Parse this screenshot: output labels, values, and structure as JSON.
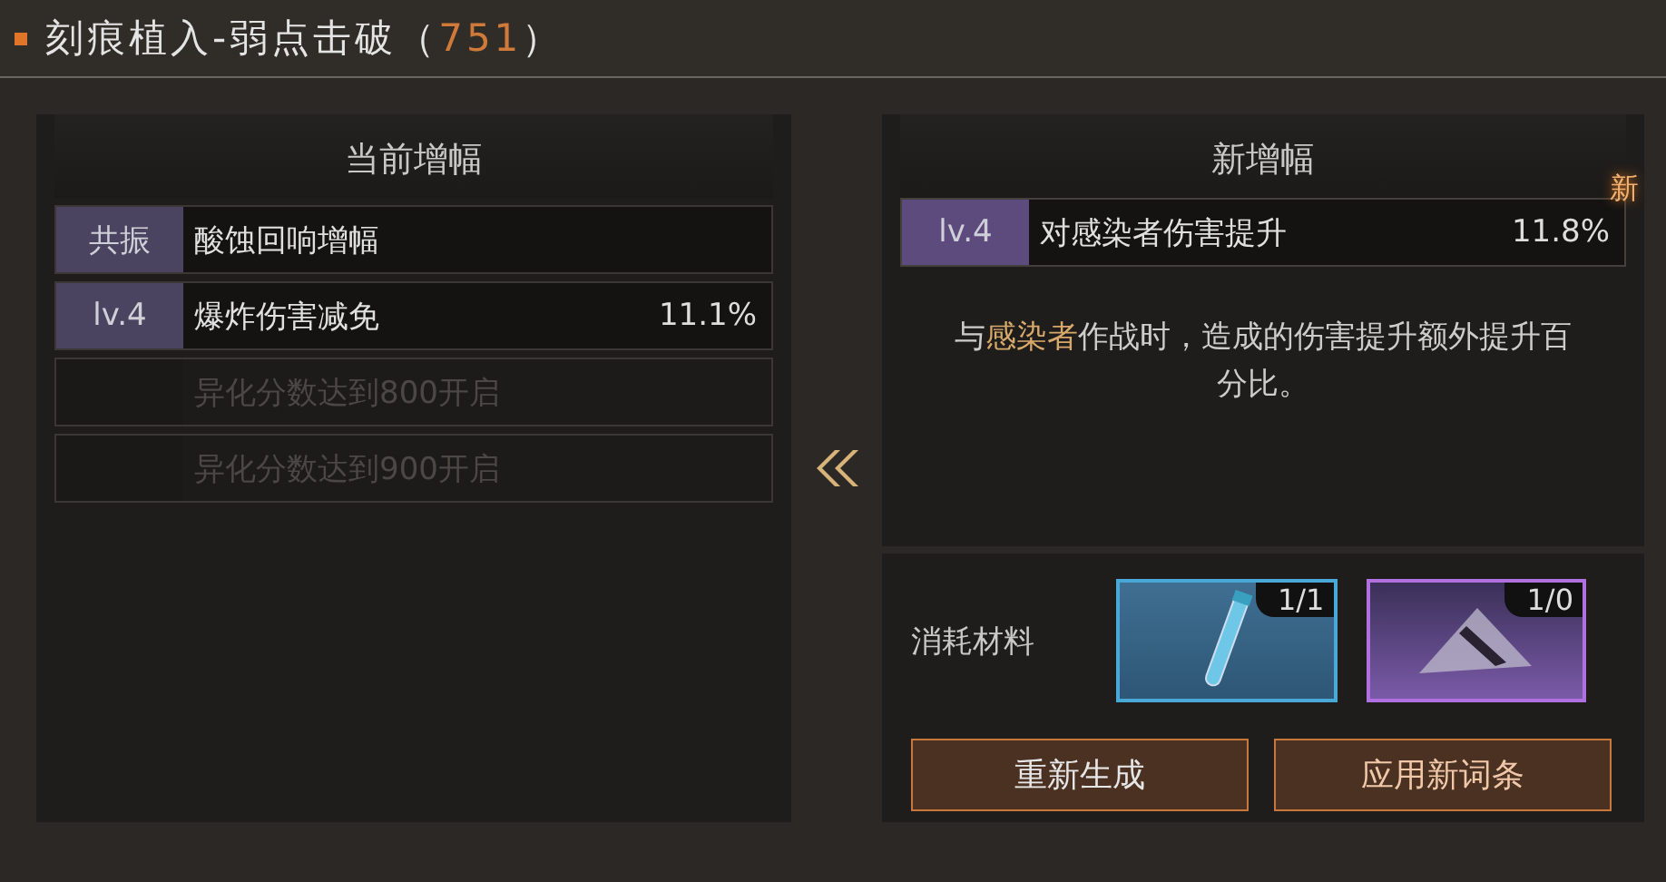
{
  "title": {
    "text": "刻痕植入-弱点击破（",
    "score": "751",
    "close": "）"
  },
  "current": {
    "heading": "当前增幅",
    "rows": [
      {
        "tag": "共振",
        "name": "酸蚀回响增幅",
        "locked": false
      },
      {
        "tag": "lv.4",
        "name": "爆炸伤害减免",
        "value": "11.1%",
        "locked": false
      },
      {
        "name": "异化分数达到800开启",
        "locked": true
      },
      {
        "name": "异化分数达到900开启",
        "locked": true
      }
    ]
  },
  "new": {
    "heading": "新增幅",
    "row": {
      "tag": "lv.4",
      "name": "对感染者伤害提升",
      "value": "11.8%",
      "badge": "新"
    },
    "description": "与**感染者**作战时，造成的伤害提升额外提升百分比。"
  },
  "materials": {
    "label": "消耗材料",
    "items": [
      {
        "kind": "vial",
        "count": "1/1",
        "color": "#4aa8d8"
      },
      {
        "kind": "scrap",
        "count": "1/0",
        "color": "#b070e0"
      }
    ]
  },
  "buttons": [
    {
      "label": "重新生成",
      "kind": "plain"
    },
    {
      "label": "应用新词条",
      "kind": "accent"
    }
  ]
}
